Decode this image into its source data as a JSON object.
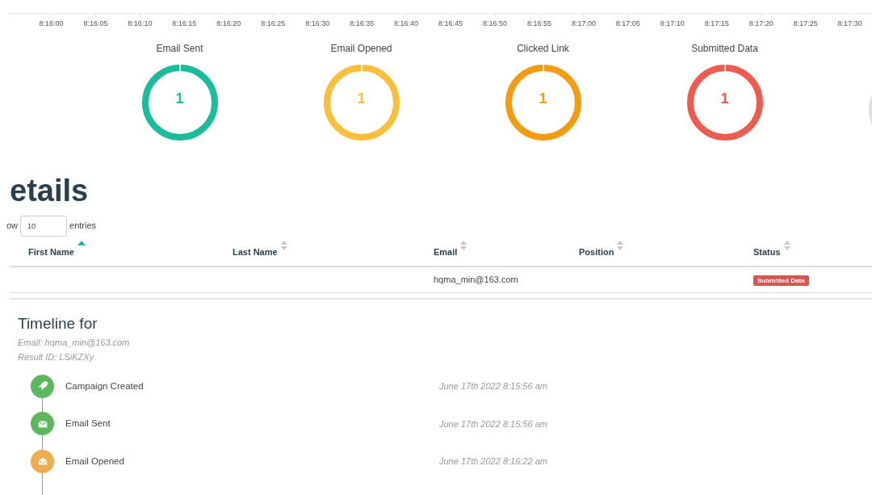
{
  "timeline_axis": {
    "ticks": [
      "8:16:00",
      "8:16:05",
      "8:16:10",
      "8:16:15",
      "8:16:20",
      "8:16:25",
      "8:16:30",
      "8:16:35",
      "8:16:40",
      "8:16:45",
      "8:16:50",
      "8:16:55",
      "8:17:00",
      "8:17:05",
      "8:17:10",
      "8:17:15",
      "8:17:20",
      "8:17:25",
      "8:17:30"
    ]
  },
  "stats": [
    {
      "label": "Email Sent",
      "count": "1",
      "color": "#1abc9c"
    },
    {
      "label": "Email Opened",
      "count": "1",
      "color": "#f9bf3b"
    },
    {
      "label": "Clicked Link",
      "count": "1",
      "color": "#f39c12"
    },
    {
      "label": "Submitted Data",
      "count": "1",
      "color": "#f05b4f"
    }
  ],
  "details": {
    "heading": "etails",
    "show_prefix": "ow",
    "page_size": "10",
    "show_suffix": "entries",
    "columns": [
      {
        "label": "First Name",
        "sorted": true
      },
      {
        "label": "Last Name",
        "sorted": false
      },
      {
        "label": "Email",
        "sorted": false
      },
      {
        "label": "Position",
        "sorted": false
      },
      {
        "label": "Status",
        "sorted": false
      }
    ],
    "rows": [
      {
        "email": "hqma_min@163.com",
        "status": "Submitted Data"
      }
    ]
  },
  "timeline": {
    "heading": "Timeline for",
    "email": "Email: hqma_min@163.com",
    "result_id": "Result ID: LSiKZXy",
    "events": [
      {
        "kind": "rocket",
        "color": "#5cb85c",
        "label": "Campaign Created",
        "time": "June 17th 2022 8:15:56 am"
      },
      {
        "kind": "envelope",
        "color": "#5cb85c",
        "label": "Email Sent",
        "time": "June 17th 2022 8:15:56 am"
      },
      {
        "kind": "envelope-open",
        "color": "#f0ad4e",
        "label": "Email Opened",
        "time": "June 17th 2022 8:16:22 am"
      }
    ]
  }
}
